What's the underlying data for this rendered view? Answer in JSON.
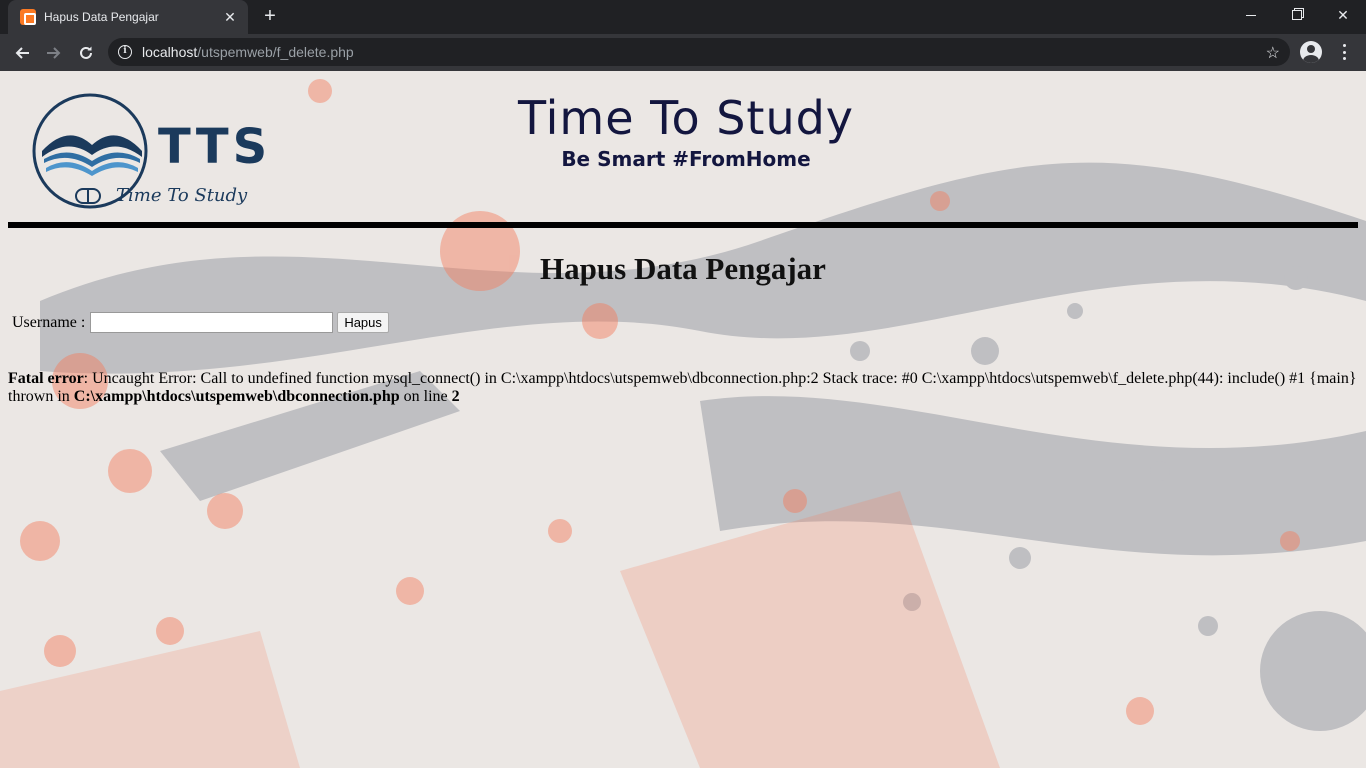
{
  "browser": {
    "tab_title": "Hapus Data Pengajar",
    "url_host": "localhost",
    "url_path": "/utspemweb/f_delete.php",
    "new_tab_symbol": "+",
    "close_symbol": "✕"
  },
  "logo": {
    "brand": "TTS",
    "tagline": "Time To Study",
    "colors": {
      "navy": "#1b3a5c",
      "blue": "#2f6ea3",
      "light_blue": "#4d95cc"
    }
  },
  "header": {
    "title": "Time To Study",
    "subtitle": "Be Smart #FromHome",
    "color": "#13163f"
  },
  "page": {
    "heading": "Hapus Data Pengajar",
    "form": {
      "username_label": "Username :",
      "username_value": "",
      "submit_label": "Hapus"
    },
    "error": {
      "label": "Fatal error",
      "message": ": Uncaught Error: Call to undefined function mysql_connect() in C:\\xampp\\htdocs\\utspemweb\\dbconnection.php:2 Stack trace: #0 C:\\xampp\\htdocs\\utspemweb\\f_delete.php(44): include() #1 {main} thrown in ",
      "file": "C:\\xampp\\htdocs\\utspemweb\\dbconnection.php",
      "on_line_text": " on line ",
      "line": "2"
    }
  },
  "theme": {
    "splash_orange": "#f47a5a",
    "splash_grey": "#8a8f99",
    "page_bg": "#e9e6e3"
  }
}
